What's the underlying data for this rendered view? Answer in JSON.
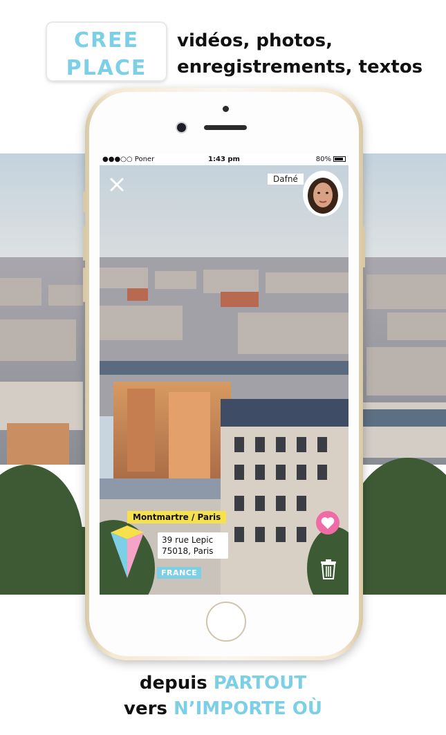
{
  "header": {
    "brand_line1": "CREE",
    "brand_line2": "PLACE",
    "tagline_line1": "vidéos, photos,",
    "tagline_line2": "enregistrements, textos"
  },
  "status_bar": {
    "carrier": "●●●○○ Poner",
    "time": "1:43 pm",
    "battery": "80%"
  },
  "post": {
    "user_name": "Dafné",
    "location_tag": "Montmartre / Paris",
    "address_line1": "39 rue Lepic",
    "address_line2": "75018, Paris",
    "country": "FRANCE"
  },
  "footer": {
    "line1_prefix": "depuis ",
    "line1_accent": "PARTOUT",
    "line2_prefix": "vers ",
    "line2_accent": "N’IMPORTE OÙ"
  },
  "colors": {
    "accent_blue": "#7dcfe6",
    "tag_yellow": "#f6e14c",
    "like_pink": "#f06ba6"
  },
  "icons": [
    "close-icon",
    "wifi-icon",
    "battery-icon",
    "heart-icon",
    "trash-icon",
    "place-pin-icon"
  ]
}
